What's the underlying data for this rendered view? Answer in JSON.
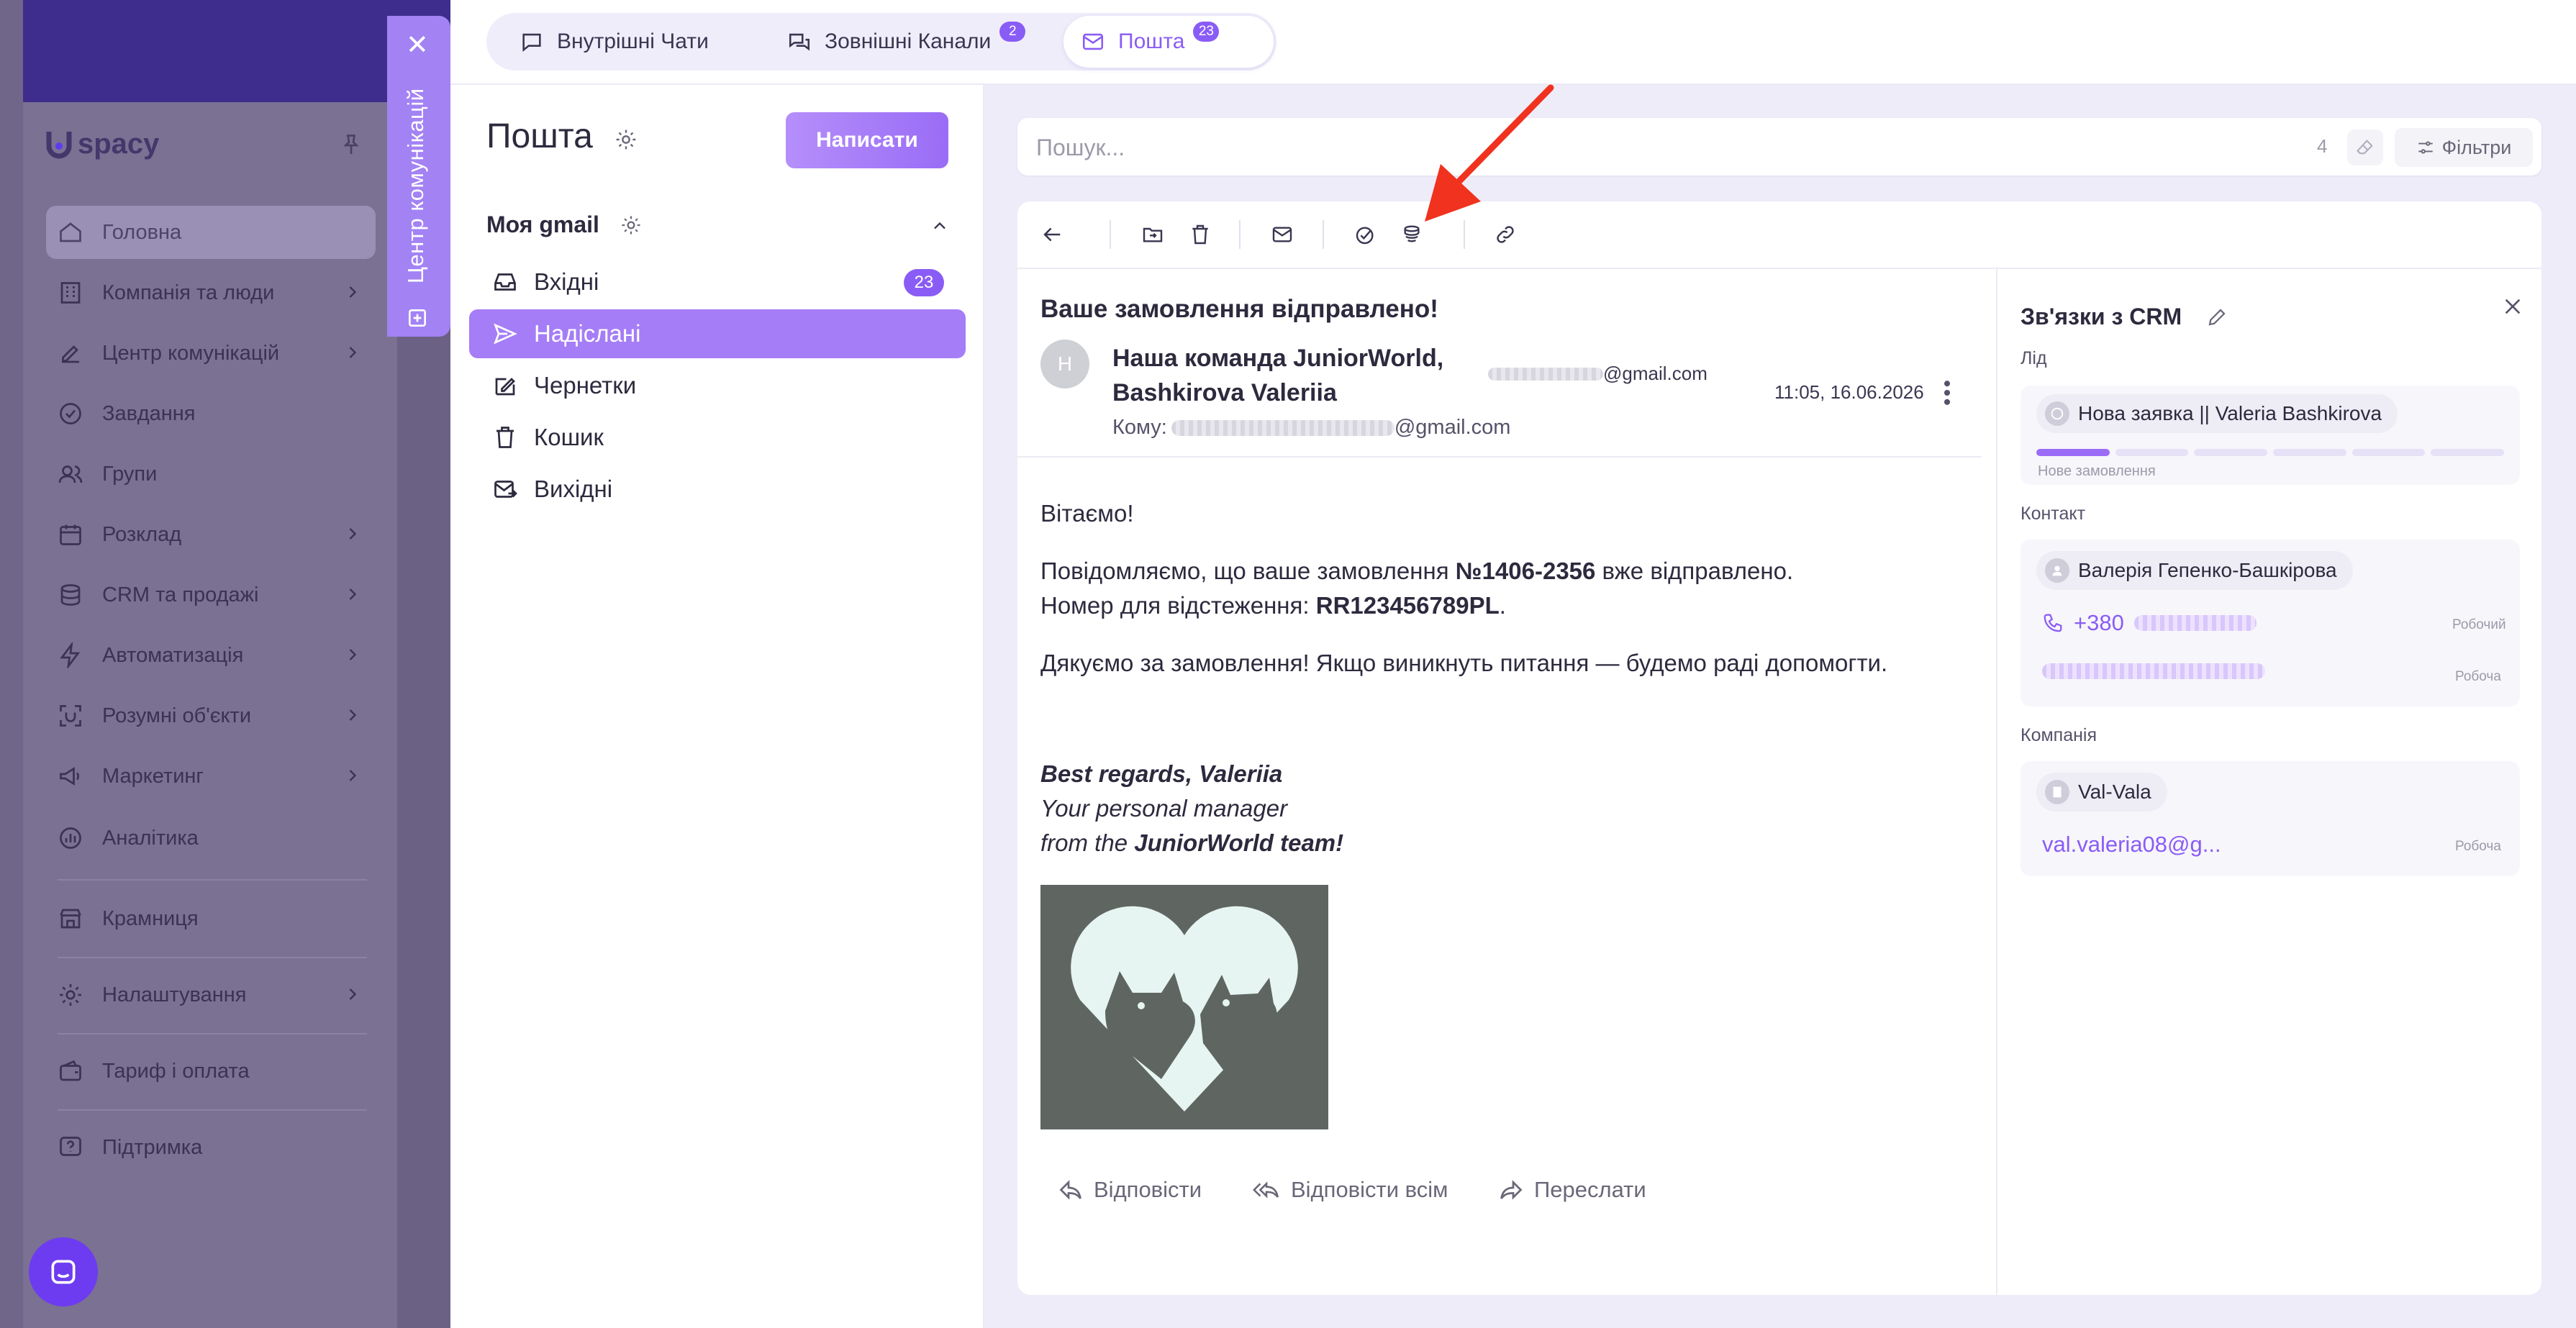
{
  "app": {
    "logo_text": "spacy",
    "sidebar_items": [
      {
        "label": "Головна"
      },
      {
        "label": "Компанія та люди"
      },
      {
        "label": "Центр комунікацій"
      },
      {
        "label": "Завдання"
      },
      {
        "label": "Групи"
      },
      {
        "label": "Розклад"
      },
      {
        "label": "CRM та продажі"
      },
      {
        "label": "Автоматизація"
      },
      {
        "label": "Розумні об'єкти"
      },
      {
        "label": "Маркетинг"
      },
      {
        "label": "Аналітика"
      },
      {
        "label": "Крамниця"
      },
      {
        "label": "Налаштування"
      },
      {
        "label": "Тариф і оплата"
      },
      {
        "label": "Підтримка"
      }
    ]
  },
  "comm_center_tab": {
    "label": "Центр комунікацій",
    "close": "✕"
  },
  "top_tabs": [
    {
      "label": "Внутрішні Чати",
      "badge": ""
    },
    {
      "label": "Зовнішні Канали",
      "badge": "2"
    },
    {
      "label": "Пошта",
      "badge": "23",
      "active": true
    }
  ],
  "mail": {
    "title": "Пошта",
    "compose_label": "Написати",
    "account": "Моя gmail",
    "folders": [
      {
        "label": "Вхідні",
        "count": "23",
        "icon": "inbox-icon"
      },
      {
        "label": "Надіслані",
        "count": "",
        "icon": "send-icon",
        "active": true
      },
      {
        "label": "Чернетки",
        "count": "",
        "icon": "draft-icon"
      },
      {
        "label": "Кошик",
        "count": "",
        "icon": "trash-icon"
      },
      {
        "label": "Вихідні",
        "count": "",
        "icon": "outbox-icon"
      }
    ]
  },
  "search": {
    "placeholder": "Пошук...",
    "count": "4",
    "filters_label": "Фільтри"
  },
  "message": {
    "subject": "Ваше замовлення відправлено!",
    "avatar_letter": "Н",
    "sender_name": "Наша команда JuniorWorld, Bashkirova Valeriia",
    "sender_email_suffix": "@gmail.com",
    "time": "11:05, 16.06.2026",
    "to_label": "Кому:",
    "to_email_suffix": "@gmail.com",
    "body": {
      "greeting": "Вітаємо!",
      "line1_a": "Повідомляємо, що ваше замовлення ",
      "order_no": "№1406-2356",
      "line1_b": " вже відправлено.",
      "line2_a": "Номер для відстеження: ",
      "tracking": "RR123456789PL",
      "line2_b": ".",
      "thanks": "Дякуємо за замовлення! Якщо виникнуть питання — будемо раді допомогти."
    },
    "signature": {
      "line1": "Best regards, Valeriia",
      "line2": "Your personal manager",
      "line3_a": "from the ",
      "line3_b": "JuniorWorld team!"
    },
    "actions": {
      "reply": "Відповісти",
      "reply_all": "Відповісти всім",
      "forward": "Переслати"
    }
  },
  "crm": {
    "title": "Зв'язки з CRM",
    "lead_label": "Лід",
    "lead_chip": "Нова заявка || Valeria Bashkirova",
    "lead_stage": "Нове замовлення",
    "lead_progress": 0.125,
    "contact_label": "Контакт",
    "contact_chip": "Валерія Гепенко-Башкірова",
    "phone_prefix": "+380",
    "phone_tag": "Робочий",
    "email_tag": "Робоча",
    "company_label": "Компанія",
    "company_chip": "Val-Vala",
    "company_email": "val.valeria08@g...",
    "company_email_tag": "Робоча"
  },
  "colors": {
    "accent": "#8a5cf6",
    "sidebar_top": "#3e2d8c",
    "arrow": "#f0321e"
  }
}
